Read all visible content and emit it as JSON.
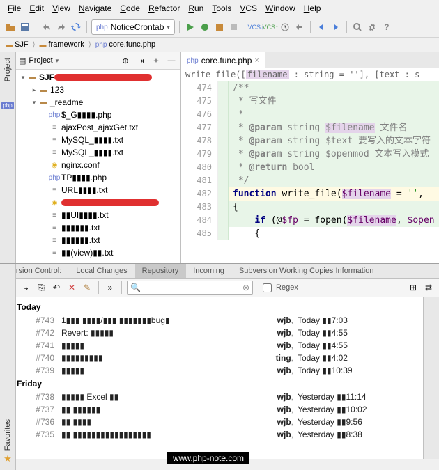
{
  "menu": [
    "File",
    "Edit",
    "View",
    "Navigate",
    "Code",
    "Refactor",
    "Run",
    "Tools",
    "VCS",
    "Window",
    "Help"
  ],
  "run_config": {
    "label": "NoticeCrontab",
    "icon": "php-icon",
    "dropdown": "▾"
  },
  "breadcrumb": [
    {
      "icon": "folder",
      "label": "SJF"
    },
    {
      "icon": "folder",
      "label": "framework"
    },
    {
      "icon": "php",
      "label": "core.func.php"
    }
  ],
  "project": {
    "title": "Project",
    "tree": [
      {
        "d": 0,
        "tw": "▾",
        "ic": "folder",
        "label": "SJF",
        "bold": true,
        "red": true
      },
      {
        "d": 1,
        "tw": "▸",
        "ic": "folder",
        "label": "123"
      },
      {
        "d": 1,
        "tw": "▾",
        "ic": "folder",
        "label": "_readme"
      },
      {
        "d": 2,
        "tw": "",
        "ic": "php",
        "label": "$_G▮▮▮▮.php"
      },
      {
        "d": 2,
        "tw": "",
        "ic": "txt",
        "label": "ajaxPost_ajaxGet.txt"
      },
      {
        "d": 2,
        "tw": "",
        "ic": "txt",
        "label": "MySQL_▮▮▮▮.txt"
      },
      {
        "d": 2,
        "tw": "",
        "ic": "txt",
        "label": "MySQL_▮▮▮▮.txt"
      },
      {
        "d": 2,
        "tw": "",
        "ic": "bulb",
        "label": "nginx.conf"
      },
      {
        "d": 2,
        "tw": "",
        "ic": "php",
        "label": "TP▮▮▮▮.php"
      },
      {
        "d": 2,
        "tw": "",
        "ic": "txt",
        "label": "URL▮▮▮▮.txt"
      },
      {
        "d": 2,
        "tw": "",
        "ic": "bulb",
        "label": "",
        "red": true
      },
      {
        "d": 2,
        "tw": "",
        "ic": "txt",
        "label": "▮▮UI▮▮▮▮.txt"
      },
      {
        "d": 2,
        "tw": "",
        "ic": "txt",
        "label": "▮▮▮▮▮▮.txt"
      },
      {
        "d": 2,
        "tw": "",
        "ic": "txt",
        "label": "▮▮▮▮▮▮.txt"
      },
      {
        "d": 2,
        "tw": "",
        "ic": "txt",
        "label": "▮▮(view)▮▮.txt"
      }
    ]
  },
  "editor": {
    "tab": {
      "icon": "php",
      "label": "core.func.php"
    },
    "signature": "write_file([filename : string = ''], [text : s",
    "lines": [
      {
        "n": 474,
        "bg": "g",
        "html": "<span class='com'>/**</span>"
      },
      {
        "n": 475,
        "bg": "g",
        "html": "<span class='com'> * 写文件</span>"
      },
      {
        "n": 476,
        "bg": "g",
        "html": "<span class='com'> *</span>"
      },
      {
        "n": 477,
        "bg": "g",
        "html": "<span class='com'> * <span class='tag'>@param</span> string <span class='hl'>$filename</span> 文件名</span>"
      },
      {
        "n": 478,
        "bg": "g",
        "html": "<span class='com'> * <span class='tag'>@param</span> string $text 要写入的文本字符</span>"
      },
      {
        "n": 479,
        "bg": "g",
        "html": "<span class='com'> * <span class='tag'>@param</span> string $openmod 文本写入模式</span>"
      },
      {
        "n": 480,
        "bg": "g",
        "html": "<span class='com'> * <span class='tag'>@return</span> bool</span>"
      },
      {
        "n": 481,
        "bg": "g",
        "html": "<span class='com'> */</span>"
      },
      {
        "n": 482,
        "bg": "g",
        "yl": true,
        "html": "<span class='kw'>function</span> <span class='fn'>write_file</span>(<span class='hl var'>$filename</span> = <span class='str'>''</span>, "
      },
      {
        "n": 483,
        "bg": "g",
        "html": "{"
      },
      {
        "n": 484,
        "bg": "g",
        "html": "    <span class='kw'>if</span> (@<span class='var'>$fp</span> = <span class='fn'>fopen</span>(<span class='hl var'>$filename</span>, <span class='var'>$open</span>"
      },
      {
        "n": 485,
        "bg": "",
        "html": "    {"
      }
    ]
  },
  "vcs": {
    "tabs": [
      "Version Control:",
      "Local Changes",
      "Repository",
      "Incoming",
      "Subversion Working Copies Information"
    ],
    "active_tab": 2,
    "regex_label": "Regex",
    "groups": [
      {
        "title": "Today",
        "rows": [
          {
            "rev": "#743",
            "msg": "1▮▮▮ ▮▮▮▮/▮▮▮ ▮▮▮▮▮▮▮bug▮",
            "auth": "wjb",
            "date": "Today ▮▮7:03"
          },
          {
            "rev": "#742",
            "msg": "Revert: ▮▮▮▮▮",
            "auth": "wjb",
            "date": "Today ▮▮4:55"
          },
          {
            "rev": "#741",
            "msg": "▮▮▮▮▮",
            "auth": "wjb",
            "date": "Today ▮▮4:55"
          },
          {
            "rev": "#740",
            "msg": "▮▮▮▮▮▮▮▮▮",
            "auth": "ting",
            "date": "Today ▮▮4:02"
          },
          {
            "rev": "#739",
            "msg": "▮▮▮▮▮",
            "auth": "wjb",
            "date": "Today ▮▮10:39"
          }
        ]
      },
      {
        "title": "Friday",
        "rows": [
          {
            "rev": "#738",
            "msg": "▮▮▮▮▮ Excel ▮▮",
            "auth": "wjb",
            "date": "Yesterday ▮▮11:14"
          },
          {
            "rev": "#737",
            "msg": "▮▮ ▮▮▮▮▮▮",
            "auth": "wjb",
            "date": "Yesterday ▮▮10:02"
          },
          {
            "rev": "#736",
            "msg": "▮▮ ▮▮▮▮",
            "auth": "wjb",
            "date": "Yesterday ▮▮9:56"
          },
          {
            "rev": "#735",
            "msg": "▮▮ ▮▮▮▮▮▮▮▮▮▮▮▮▮▮▮▮▮",
            "auth": "wjb",
            "date": "Yesterday ▮▮8:38"
          }
        ]
      }
    ]
  },
  "sidebar_left": [
    "Project"
  ],
  "sidebar_left2_icon": "php",
  "favorites_label": "Favorites",
  "watermark": "www.php-note.com"
}
